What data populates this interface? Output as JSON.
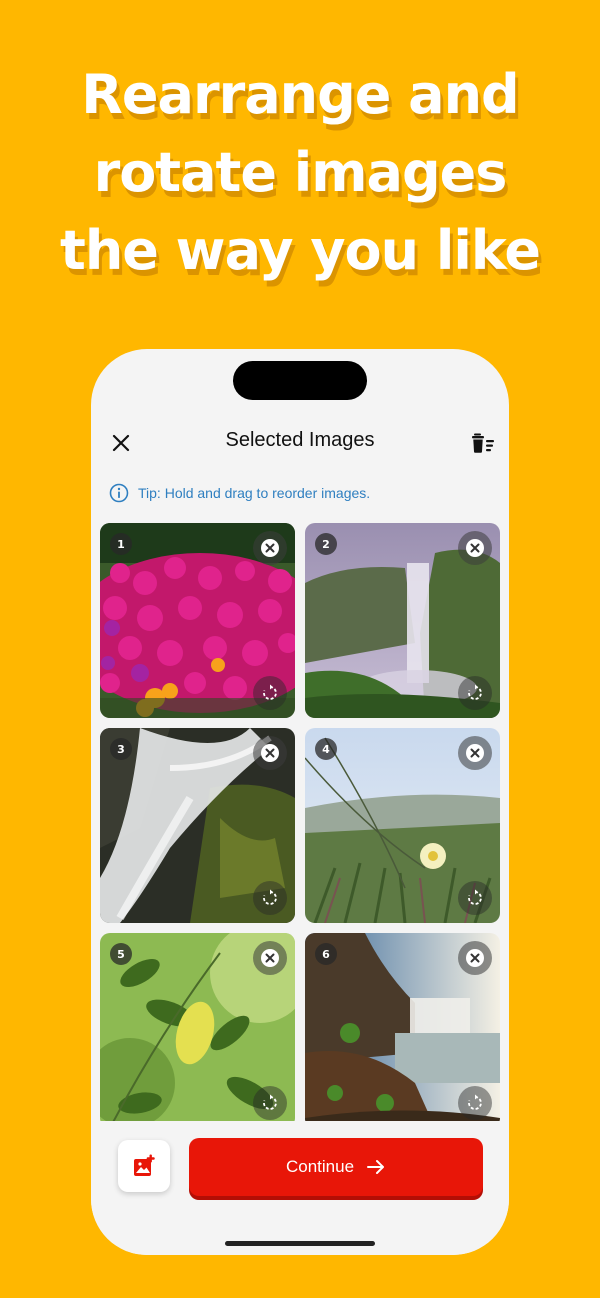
{
  "promo": {
    "headline_lines": [
      "Rearrange and",
      "rotate images",
      "the way you like"
    ],
    "background_color": "#FFB700"
  },
  "nav": {
    "title": "Selected Images",
    "close_icon": "close-icon",
    "trash_icon": "delete-all-icon"
  },
  "tip": {
    "text": "Tip: Hold and drag to reorder images.",
    "icon": "info-icon"
  },
  "images": [
    {
      "index": "1",
      "subject": "pink flowers"
    },
    {
      "index": "2",
      "subject": "waterfall cliff"
    },
    {
      "index": "3",
      "subject": "mossy waterfall"
    },
    {
      "index": "4",
      "subject": "coastal flower"
    },
    {
      "index": "5",
      "subject": "green leaves"
    },
    {
      "index": "6",
      "subject": "waterfall at sunrise"
    }
  ],
  "bottom_bar": {
    "add_icon": "add-image-icon",
    "continue_label": "Continue",
    "continue_icon": "arrow-right-icon",
    "accent_color": "#E81608"
  }
}
